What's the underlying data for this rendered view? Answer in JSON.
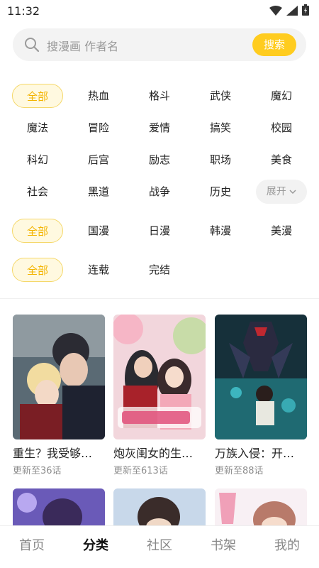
{
  "status_bar": {
    "time": "11:32"
  },
  "search": {
    "placeholder": "搜漫画 作者名",
    "button_label": "搜索"
  },
  "filters": {
    "genres": [
      "全部",
      "热血",
      "格斗",
      "武侠",
      "魔幻",
      "魔法",
      "冒险",
      "爱情",
      "搞笑",
      "校园",
      "科幻",
      "后宫",
      "励志",
      "职场",
      "美食",
      "社会",
      "黑道",
      "战争",
      "历史"
    ],
    "expand_label": "展开",
    "regions": [
      "全部",
      "国漫",
      "日漫",
      "韩漫",
      "美漫"
    ],
    "status": [
      "全部",
      "连载",
      "完结"
    ]
  },
  "comics": [
    {
      "title": "重生？我受够…",
      "update": "更新至36话"
    },
    {
      "title": "炮灰闺女的生…",
      "update": "更新至613话"
    },
    {
      "title": "万族入侵：开…",
      "update": "更新至88话"
    }
  ],
  "bottom_nav": [
    "首页",
    "分类",
    "社区",
    "书架",
    "我的"
  ],
  "colors": {
    "accent": "#ffcc1f",
    "active_tag_text": "#f3b400"
  }
}
